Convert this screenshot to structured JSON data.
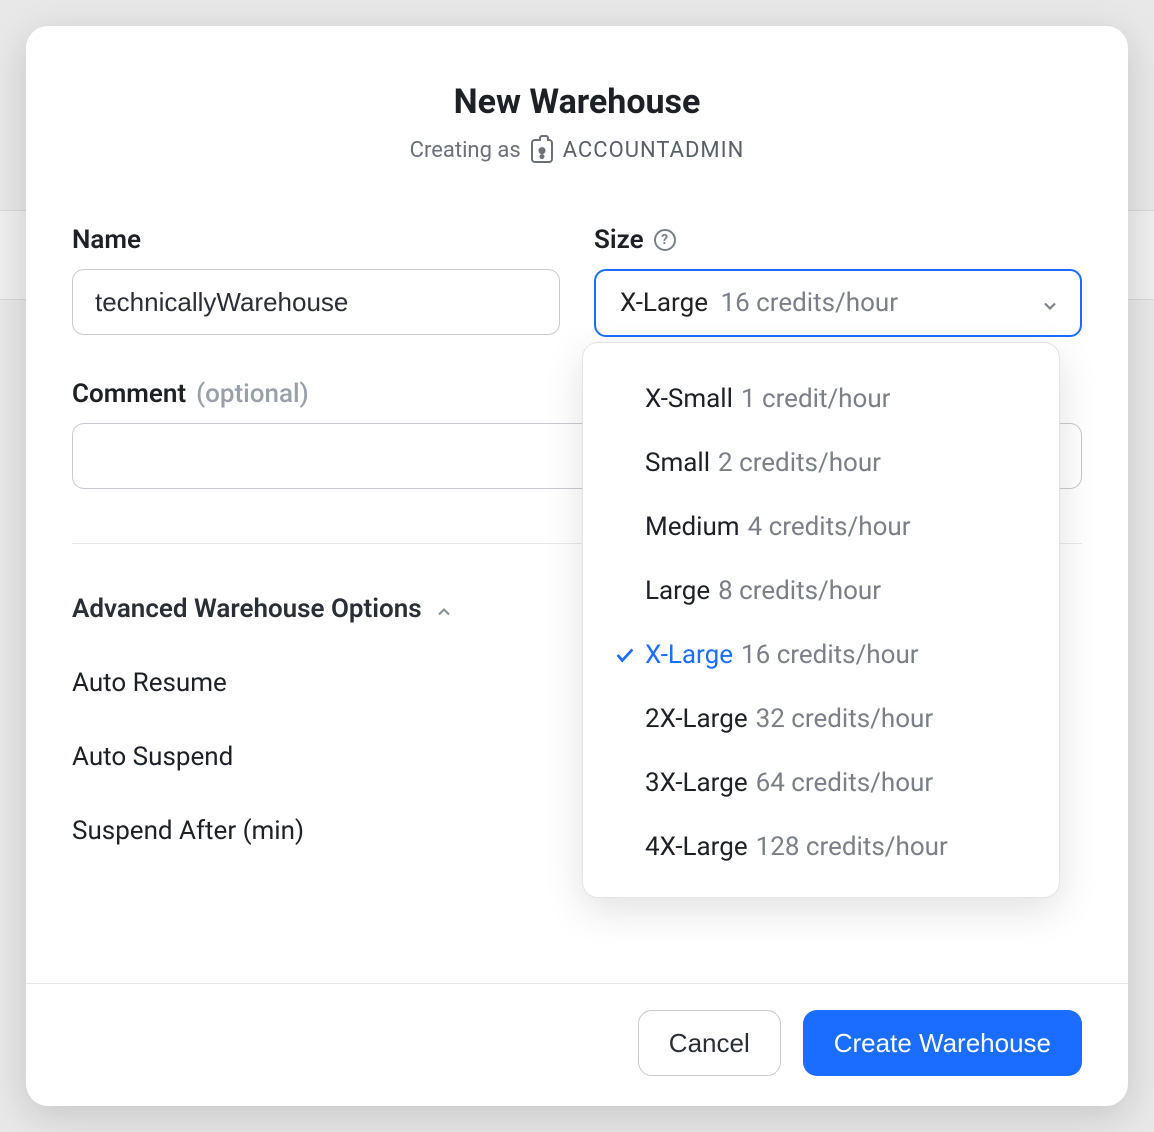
{
  "header": {
    "title": "New Warehouse",
    "subtitle_prefix": "Creating as",
    "role": "ACCOUNTADMIN"
  },
  "form": {
    "name_label": "Name",
    "name_value": "technicallyWarehouse",
    "size_label": "Size",
    "size_selected_name": "X-Large",
    "size_selected_credits": "16 credits/hour",
    "comment_label": "Comment",
    "comment_optional": "(optional)",
    "comment_value": ""
  },
  "size_options": [
    {
      "name": "X-Small",
      "credits": "1 credit/hour",
      "selected": false
    },
    {
      "name": "Small",
      "credits": "2 credits/hour",
      "selected": false
    },
    {
      "name": "Medium",
      "credits": "4 credits/hour",
      "selected": false
    },
    {
      "name": "Large",
      "credits": "8 credits/hour",
      "selected": false
    },
    {
      "name": "X-Large",
      "credits": "16 credits/hour",
      "selected": true
    },
    {
      "name": "2X-Large",
      "credits": "32 credits/hour",
      "selected": false
    },
    {
      "name": "3X-Large",
      "credits": "64 credits/hour",
      "selected": false
    },
    {
      "name": "4X-Large",
      "credits": "128 credits/hour",
      "selected": false
    }
  ],
  "advanced": {
    "header": "Advanced Warehouse Options",
    "auto_resume_label": "Auto Resume",
    "auto_suspend_label": "Auto Suspend",
    "suspend_after_label": "Suspend After (min)"
  },
  "footer": {
    "cancel": "Cancel",
    "create": "Create Warehouse"
  }
}
